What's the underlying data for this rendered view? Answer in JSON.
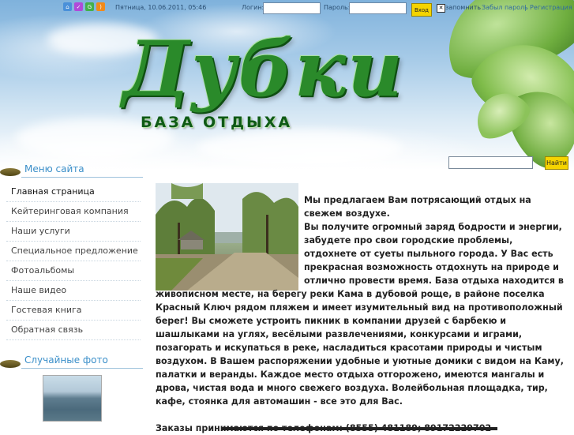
{
  "topbar": {
    "datetime": "Пятница, 10.06.2011, 05:46",
    "login_label": "Логин:",
    "password_label": "Пароль:",
    "login_button": "Вход",
    "remember_label": "запомнить",
    "remember_checked": true,
    "forgot_link": "Забыл пароль",
    "separator": "|",
    "register_link": "Регистрация",
    "icons": [
      {
        "name": "home-icon",
        "color": "#4a90d9"
      },
      {
        "name": "pm-icon",
        "color": "#b04ad9"
      },
      {
        "name": "gear-icon",
        "color": "#43b04a"
      },
      {
        "name": "rss-icon",
        "color": "#f08a1c"
      }
    ]
  },
  "header": {
    "logo_title": "Дубки",
    "logo_subtitle": "БАЗА ОТДЫХА"
  },
  "search": {
    "input_value": "",
    "button": "Найти"
  },
  "sidebar": {
    "menu_title": "Меню сайта",
    "items": [
      {
        "label": "Главная страница",
        "active": true
      },
      {
        "label": "Кейтеринговая компания",
        "active": false
      },
      {
        "label": "Наши услуги",
        "active": false
      },
      {
        "label": "Специальное предложение",
        "active": false
      },
      {
        "label": "Фотоальбомы",
        "active": false
      },
      {
        "label": "Наше видео",
        "active": false
      },
      {
        "label": "Гостевая книга",
        "active": false
      },
      {
        "label": "Обратная связь",
        "active": false
      }
    ],
    "random_photo_title": "Случайные фото"
  },
  "content": {
    "paragraphs": [
      "Мы предлагаем Вам потрясающий отдых на свежем воздухе.",
      "Вы получите огромный заряд бодрости и энергии, забудете про свои городские проблемы, отдохнете от суеты пыльного города. У Вас есть прекрасная возможность отдохнуть на природе и отлично провести время. База отдыха находится  в живописном месте, на берегу реки Кама в дубовой роще, в районе поселка Красный Ключ рядом пляжем и имеет изумительный вид на противоположный берег!  Вы сможете устроить пикник в компании друзей с барбекю и шашлыками на углях, весёлыми развлечениями, конкурсами и играми, позагорать и искупаться в реке, насладиться красотами природы и чистым воздухом. В Вашем распоряжении удобные и уютные домики с видом на Каму, палатки и веранды. Каждое место отдыха отгорожено, имеются мангалы и дрова, чистая вода и много свежего воздуха. Волейбольная площадка, тир, кафе, стоянка для автомашин - все это для Вас.",
      "Заказы принимаются по телефонам: (8555) 481189; 89172229702"
    ]
  }
}
